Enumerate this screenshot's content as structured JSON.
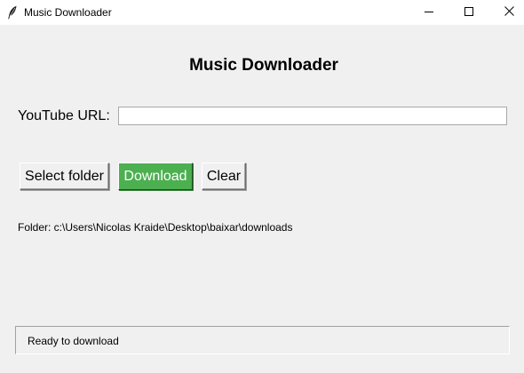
{
  "window": {
    "title": "Music Downloader"
  },
  "title_bar_icons": {
    "app_icon": "feather-icon",
    "minimize": "minimize-icon",
    "maximize": "maximize-icon",
    "close": "close-icon"
  },
  "main": {
    "heading": "Music Downloader",
    "url_label": "YouTube URL:",
    "url_value": "",
    "buttons": {
      "select_folder": "Select folder",
      "download": "Download",
      "clear": "Clear"
    },
    "folder_text": "Folder: c:\\Users\\Nicolas Kraide\\Desktop\\baixar\\downloads"
  },
  "status": {
    "text": "Ready to download"
  },
  "colors": {
    "background": "#f0f0f0",
    "download_button": "#4caf50",
    "download_text": "#ffffff"
  }
}
